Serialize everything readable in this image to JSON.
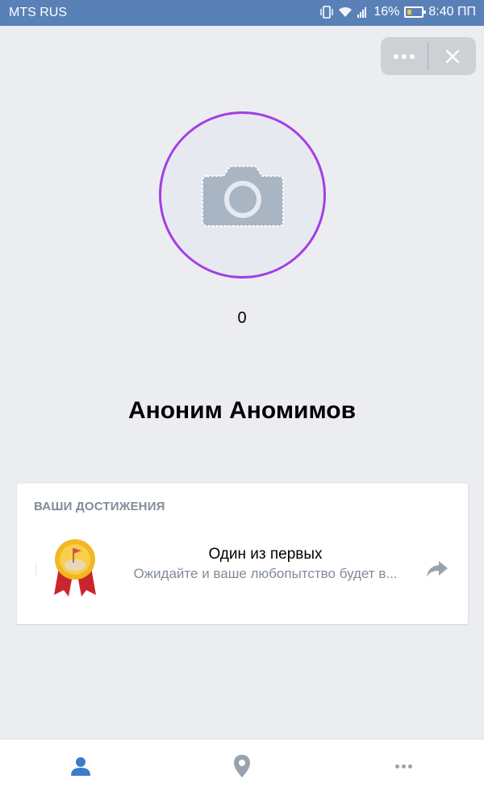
{
  "status_bar": {
    "carrier": "MTS RUS",
    "battery": "16%",
    "time": "8:40 ПП"
  },
  "header": {
    "more_icon": "more-dots-icon",
    "close_icon": "close-icon"
  },
  "profile": {
    "avatar_icon": "camera-icon",
    "score": "0",
    "name": "Аноним Аномимов"
  },
  "achievements": {
    "title": "ВАШИ ДОСТИЖЕНИЯ",
    "items": [
      {
        "icon": "medal-icon",
        "name": "Один из первых",
        "description": "Ожидайте и ваше любопытство будет в...",
        "action_icon": "share-arrow-icon"
      }
    ]
  },
  "bottom_nav": {
    "items": [
      {
        "icon": "user-icon",
        "active": true
      },
      {
        "icon": "map-pin-icon",
        "active": false
      },
      {
        "icon": "more-icon",
        "active": false
      }
    ]
  },
  "colors": {
    "status_bar": "#5a80b8",
    "avatar_ring": "#a53ee6",
    "background": "#ebedf1",
    "active_nav": "#3f7cc6",
    "inactive_nav": "#99a2ad"
  }
}
